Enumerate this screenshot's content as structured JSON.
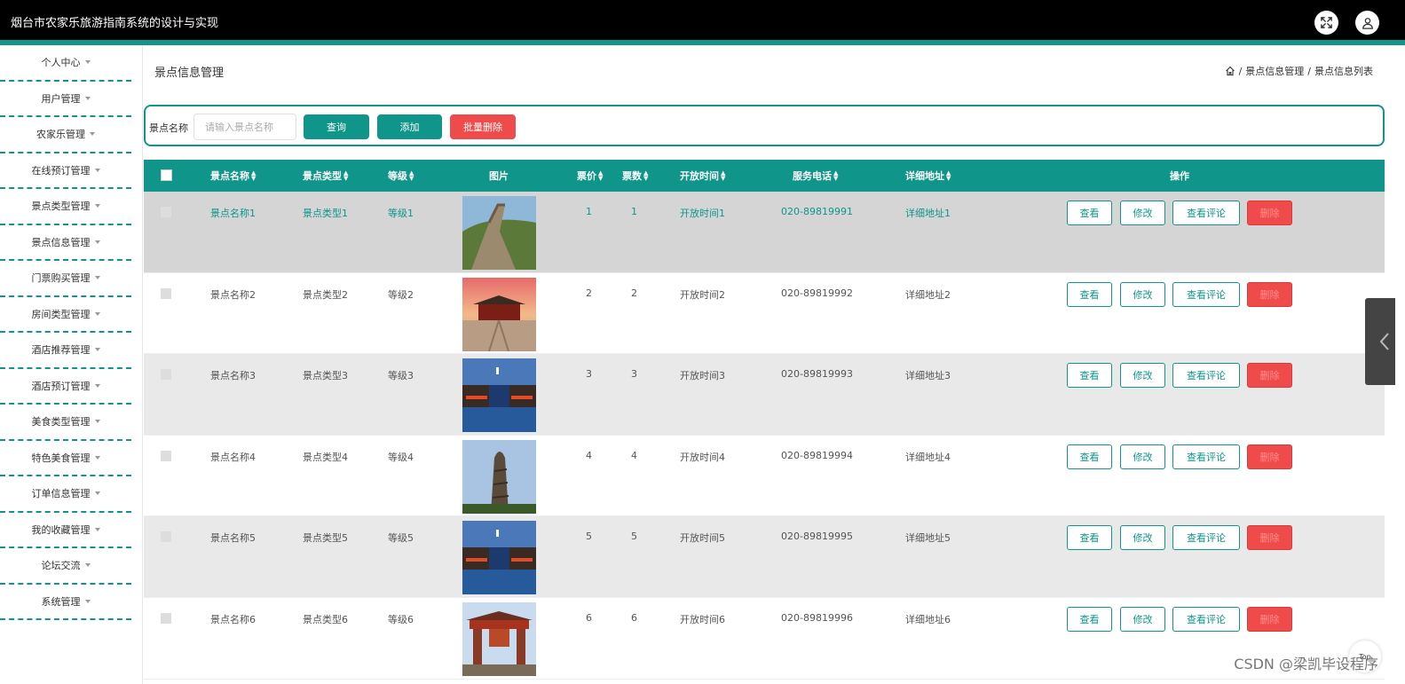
{
  "app": {
    "title": "烟台市农家乐旅游指南系统的设计与实现",
    "accent": "#0f958a"
  },
  "sidebar": {
    "items": [
      {
        "label": "个人中心"
      },
      {
        "label": "用户管理"
      },
      {
        "label": "农家乐管理"
      },
      {
        "label": "在线预订管理"
      },
      {
        "label": "景点类型管理"
      },
      {
        "label": "景点信息管理"
      },
      {
        "label": "门票购买管理"
      },
      {
        "label": "房间类型管理"
      },
      {
        "label": "酒店推荐管理"
      },
      {
        "label": "酒店预订管理"
      },
      {
        "label": "美食类型管理"
      },
      {
        "label": "特色美食管理"
      },
      {
        "label": "订单信息管理"
      },
      {
        "label": "我的收藏管理"
      },
      {
        "label": "论坛交流"
      },
      {
        "label": "系统管理"
      }
    ]
  },
  "page": {
    "title": "景点信息管理"
  },
  "breadcrumb": {
    "sep": "/",
    "level1": "景点信息管理",
    "level2": "景点信息列表"
  },
  "search": {
    "label": "景点名称",
    "placeholder": "请输入景点名称",
    "query_btn": "查询",
    "add_btn": "添加",
    "batch_delete_btn": "批量删除"
  },
  "table": {
    "headers": {
      "name": "景点名称",
      "type": "景点类型",
      "level": "等级",
      "image": "图片",
      "price": "票价",
      "count": "票数",
      "open_time": "开放时间",
      "phone": "服务电话",
      "address": "详细地址",
      "actions": "操作"
    },
    "action_labels": {
      "view": "查看",
      "edit": "修改",
      "comments": "查看评论",
      "delete": "删除"
    },
    "rows": [
      {
        "name": "景点名称1",
        "type": "景点类型1",
        "level": "等级1",
        "price": "1",
        "count": "1",
        "open_time": "开放时间1",
        "phone": "020-89819991",
        "address": "详细地址1",
        "image": "great-wall-photo"
      },
      {
        "name": "景点名称2",
        "type": "景点类型2",
        "level": "等级2",
        "price": "2",
        "count": "2",
        "open_time": "开放时间2",
        "phone": "020-89819992",
        "address": "详细地址2",
        "image": "palace-gate-photo"
      },
      {
        "name": "景点名称3",
        "type": "景点类型3",
        "level": "等级3",
        "price": "3",
        "count": "3",
        "open_time": "开放时间3",
        "phone": "020-89819993",
        "address": "详细地址3",
        "image": "water-town-night-photo"
      },
      {
        "name": "景点名称4",
        "type": "景点类型4",
        "level": "等级4",
        "price": "4",
        "count": "4",
        "open_time": "开放时间4",
        "phone": "020-89819994",
        "address": "详细地址4",
        "image": "stone-pillar-photo"
      },
      {
        "name": "景点名称5",
        "type": "景点类型5",
        "level": "等级5",
        "price": "5",
        "count": "5",
        "open_time": "开放时间5",
        "phone": "020-89819995",
        "address": "详细地址5",
        "image": "water-town-night-photo"
      },
      {
        "name": "景点名称6",
        "type": "景点类型6",
        "level": "等级6",
        "price": "6",
        "count": "6",
        "open_time": "开放时间6",
        "phone": "020-89819996",
        "address": "详细地址6",
        "image": "archway-photo"
      }
    ]
  },
  "footer": {
    "watermark": "CSDN @梁凯毕设程序",
    "top_label": "Top"
  }
}
